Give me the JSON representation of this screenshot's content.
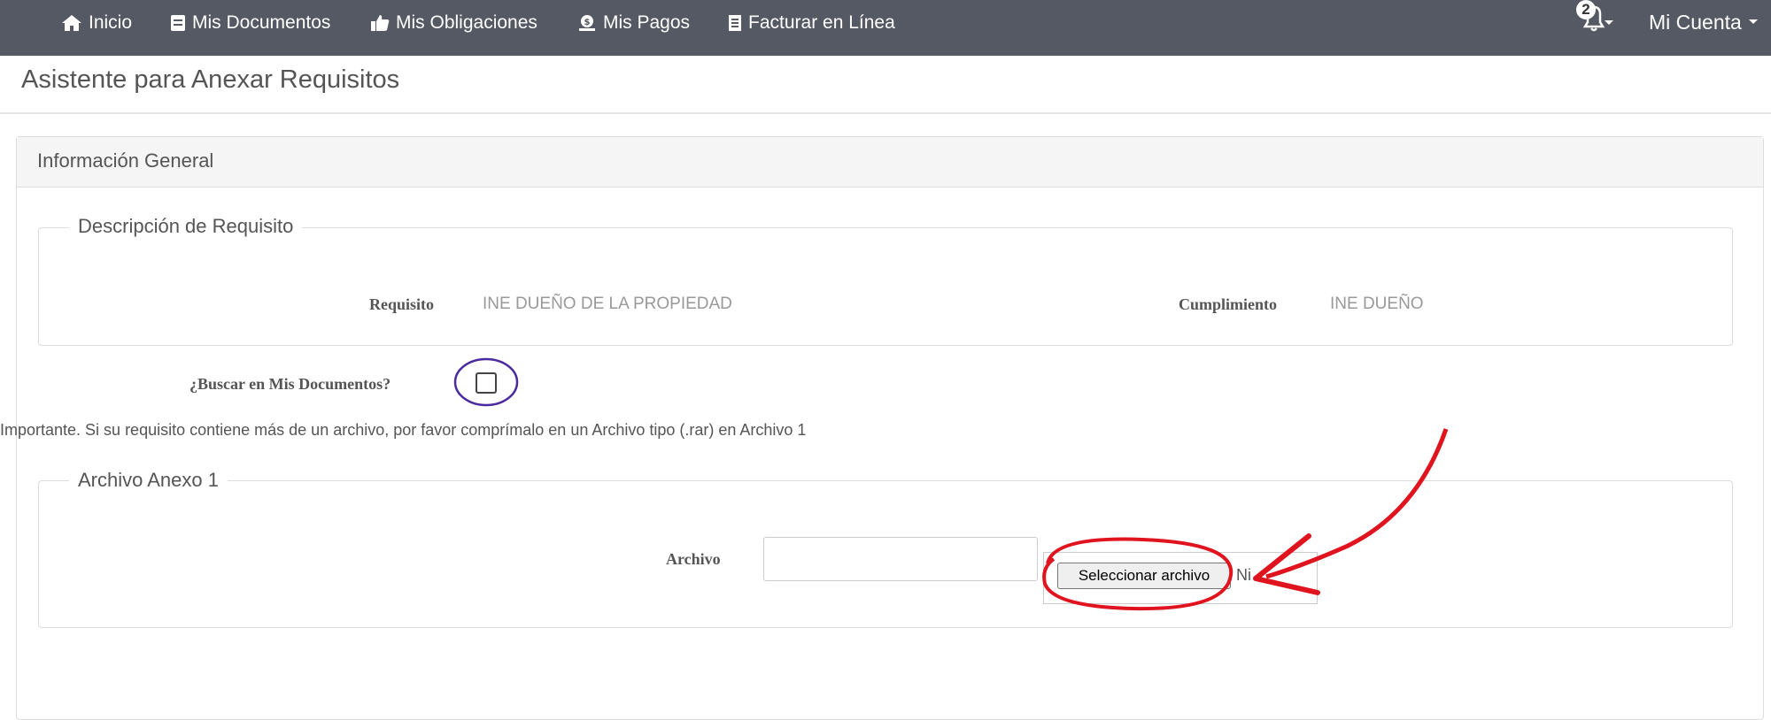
{
  "nav": {
    "items": [
      {
        "label": "Inicio",
        "icon": "home-icon"
      },
      {
        "label": "Mis Documentos",
        "icon": "document-icon"
      },
      {
        "label": "Mis Obligaciones",
        "icon": "thumbs-up-icon"
      },
      {
        "label": "Mis Pagos",
        "icon": "payment-icon"
      },
      {
        "label": "Facturar en Línea",
        "icon": "invoice-icon"
      }
    ],
    "notifications_count": "2",
    "account_label": "Mi Cuenta"
  },
  "page": {
    "title": "Asistente para Anexar Requisitos"
  },
  "panel": {
    "title": "Información General",
    "description": {
      "legend": "Descripción de Requisito",
      "requisito_label": "Requisito",
      "requisito_value": "INE DUEÑO DE LA PROPIEDAD",
      "cumplimiento_label": "Cumplimiento",
      "cumplimiento_value": "INE DUEÑO"
    },
    "search_docs_label": "¿Buscar en Mis Documentos?",
    "search_docs_checked": false,
    "important_note": "Importante. Si su requisito contiene más de un archivo, por favor comprímalo en un Archivo tipo (.rar) en Archivo 1",
    "annex": {
      "legend": "Archivo Anexo 1",
      "archivo_label": "Archivo",
      "file_button_label": "Seleccionar archivo",
      "file_status": "Ni"
    }
  },
  "colors": {
    "navbar": "#545963",
    "annotation_red": "#e0141e",
    "annotation_purple": "#4b2a9e"
  }
}
